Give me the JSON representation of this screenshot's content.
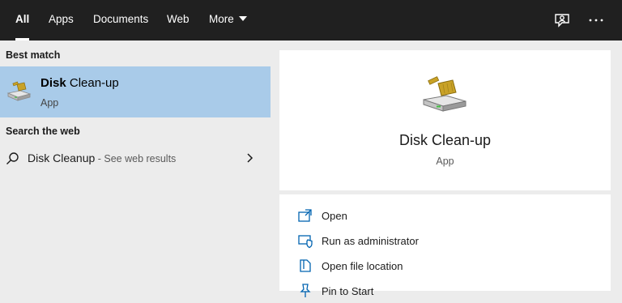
{
  "tabs": [
    {
      "label": "All",
      "active": true
    },
    {
      "label": "Apps"
    },
    {
      "label": "Documents"
    },
    {
      "label": "Web"
    },
    {
      "label": "More"
    }
  ],
  "top_icons": [
    "feedback-icon",
    "more-options-icon"
  ],
  "best_match": {
    "heading": "Best match",
    "name_bold": "Disk",
    "name_rest": " Clean-up",
    "type": "App"
  },
  "search_web": {
    "heading": "Search the web",
    "query": "Disk Cleanup",
    "suffix": " - See web results"
  },
  "detail": {
    "title": "Disk Clean-up",
    "type": "App"
  },
  "actions": [
    {
      "label": "Open",
      "icon": "open-icon"
    },
    {
      "label": "Run as administrator",
      "icon": "shield-icon"
    },
    {
      "label": "Open file location",
      "icon": "file-location-icon"
    },
    {
      "label": "Pin to Start",
      "icon": "pin-icon"
    }
  ],
  "colors": {
    "topbar": "#202020",
    "selection": "#a9cbe9",
    "accent_icon": "#0063b1"
  }
}
